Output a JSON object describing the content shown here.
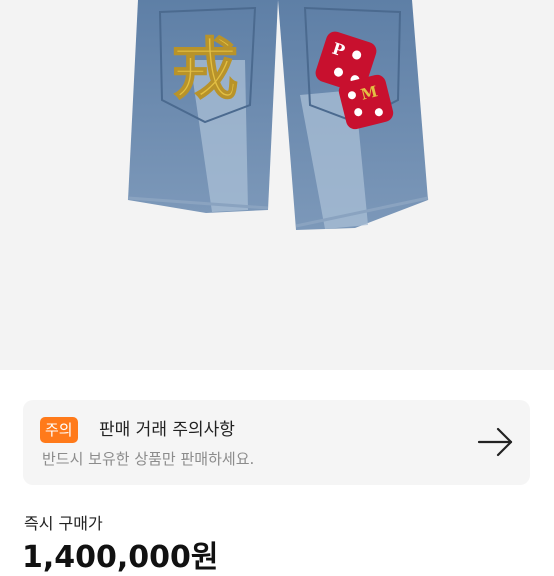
{
  "notice": {
    "badge": "주의",
    "title": "판매 거래 주의사항",
    "subtitle": "반드시 보유한 상품만 판매하세요."
  },
  "price": {
    "label": "즉시 구매가",
    "value": "1,400,000원"
  },
  "image": {
    "subject": "denim shorts with dice and kanji embroidery",
    "embroidered_glyph": "戎",
    "dice_letters": [
      "P",
      "M"
    ]
  },
  "colors": {
    "badge_orange": "#ff7a1a",
    "card_bg": "#f5f5f5",
    "dice_red": "#c8102e",
    "denim": "#6f8fb3",
    "gold": "#e3c043"
  },
  "icons": {
    "notice_arrow": "arrow-right-icon"
  }
}
